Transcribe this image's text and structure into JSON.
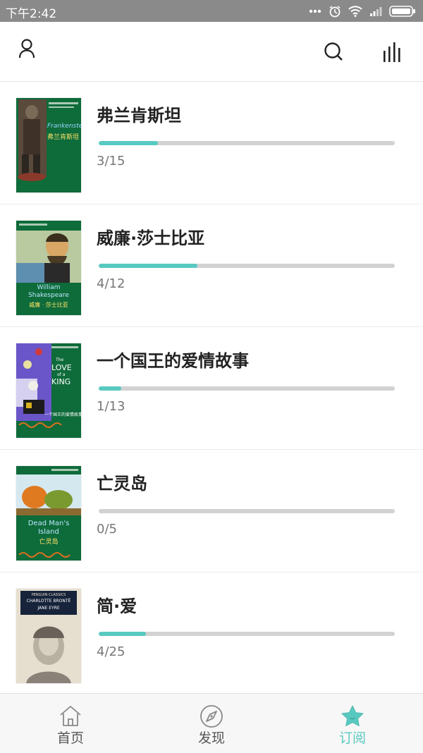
{
  "status_bar": {
    "time": "下午2:42"
  },
  "books": [
    {
      "title": "弗兰肯斯坦",
      "progress_text": "3/15",
      "progress_fraction": 0.2,
      "cover": {
        "text_lines": [
          "Frankenstein",
          "弗兰肯斯坦"
        ]
      }
    },
    {
      "title": "威廉·莎士比亚",
      "progress_text": "4/12",
      "progress_fraction": 0.333,
      "cover": {
        "text_lines": [
          "William",
          "Shakespeare",
          "威廉 · 莎士比亚"
        ]
      }
    },
    {
      "title": "一个国王的爱情故事",
      "progress_text": "1/13",
      "progress_fraction": 0.077,
      "cover": {
        "text_lines": [
          "The",
          "LOVE",
          "of a",
          "KING",
          "一个国王的爱情故事"
        ]
      }
    },
    {
      "title": "亡灵岛",
      "progress_text": "0/5",
      "progress_fraction": 0,
      "cover": {
        "text_lines": [
          "Dead Man's",
          "Island",
          "亡灵岛"
        ]
      }
    },
    {
      "title": "简·爱",
      "progress_text": "4/25",
      "progress_fraction": 0.16,
      "cover": {
        "text_lines": [
          "PENGUIN CLASSICS",
          "CHARLOTTE BRONTË",
          "JANE EYRE"
        ]
      }
    }
  ],
  "tabs": [
    {
      "label": "首页",
      "icon": "home-icon",
      "active": false
    },
    {
      "label": "发现",
      "icon": "compass-icon",
      "active": false
    },
    {
      "label": "订阅",
      "icon": "star-icon",
      "active": true
    }
  ],
  "colors": {
    "accent": "#58c9c0",
    "track": "#d2d2d2",
    "status_bar": "#8a8a8a",
    "cover_green": "#0e6b3a"
  }
}
